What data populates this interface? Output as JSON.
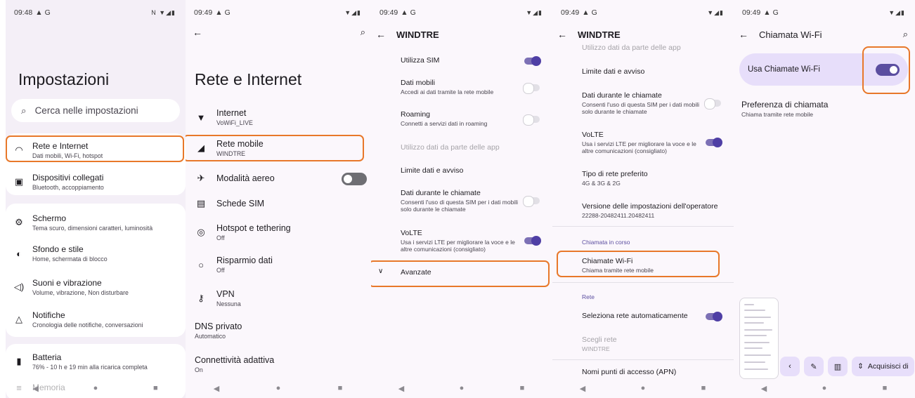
{
  "colors": {
    "highlight": "#e8782a",
    "accent": "#5b4ea0",
    "card_bg": "#e7defa"
  },
  "s1": {
    "time": "09:48",
    "status_icons": "▲ G",
    "status_right": "N ▼◢▮",
    "title": "Impostazioni",
    "search_placeholder": "Cerca nelle impostazioni",
    "items": [
      {
        "title": "Rete e Internet",
        "sub": "Dati mobili, Wi-Fi, hotspot",
        "icon": "wifi-icon"
      },
      {
        "title": "Dispositivi collegati",
        "sub": "Bluetooth, accoppiamento",
        "icon": "devices-icon"
      },
      {
        "title": "Schermo",
        "sub": "Tema scuro, dimensioni caratteri, luminosità",
        "icon": "brightness-icon"
      },
      {
        "title": "Sfondo e stile",
        "sub": "Home, schermata di blocco",
        "icon": "palette-icon"
      },
      {
        "title": "Suoni e vibrazione",
        "sub": "Volume, vibrazione, Non disturbare",
        "icon": "volume-icon"
      },
      {
        "title": "Notifiche",
        "sub": "Cronologia delle notifiche, conversazioni",
        "icon": "bell-icon"
      },
      {
        "title": "Batteria",
        "sub": "76% - 10 h e 19 min alla ricarica completa",
        "icon": "battery-icon"
      },
      {
        "title": "Memoria",
        "sub": "",
        "icon": "storage-icon"
      }
    ]
  },
  "s2": {
    "time": "09:49",
    "title": "Rete e Internet",
    "items": [
      {
        "title": "Internet",
        "sub": "VoWiFi_LIVE"
      },
      {
        "title": "Rete mobile",
        "sub": "WINDTRE"
      },
      {
        "title": "Modalità aereo",
        "sub": ""
      },
      {
        "title": "Schede SIM",
        "sub": ""
      },
      {
        "title": "Hotspot e tethering",
        "sub": "Off"
      },
      {
        "title": "Risparmio dati",
        "sub": "Off"
      },
      {
        "title": "VPN",
        "sub": "Nessuna"
      },
      {
        "title": "DNS privato",
        "sub": "Automatico"
      },
      {
        "title": "Connettività adattiva",
        "sub": "On"
      }
    ]
  },
  "s3": {
    "time": "09:49",
    "title": "WINDTRE",
    "rows": [
      {
        "title": "Utilizza SIM",
        "sub": ""
      },
      {
        "title": "Dati mobili",
        "sub": "Accedi ai dati tramite la rete mobile"
      },
      {
        "title": "Roaming",
        "sub": "Connetti a servizi dati in roaming"
      },
      {
        "title": "Utilizzo dati da parte delle app",
        "sub": ""
      },
      {
        "title": "Limite dati e avviso",
        "sub": ""
      },
      {
        "title": "Dati durante le chiamate",
        "sub": "Consenti l'uso di questa SIM per i dati mobili solo durante le chiamate"
      },
      {
        "title": "VoLTE",
        "sub": "Usa i servizi LTE per migliorare la voce e le altre comunicazioni (consigliato)"
      },
      {
        "title": "Avanzate",
        "sub": ""
      }
    ]
  },
  "s4": {
    "time": "09:49",
    "title": "WINDTRE",
    "rows": [
      {
        "title": "Utilizzo dati da parte delle app",
        "sub": ""
      },
      {
        "title": "Limite dati e avviso",
        "sub": ""
      },
      {
        "title": "Dati durante le chiamate",
        "sub": "Consenti l'uso di questa SIM per i dati mobili solo durante le chiamate"
      },
      {
        "title": "VoLTE",
        "sub": "Usa i servizi LTE per migliorare la voce e le altre comunicazioni (consigliato)"
      },
      {
        "title": "Tipo di rete preferito",
        "sub": "4G & 3G & 2G"
      },
      {
        "title": "Versione delle impostazioni dell'operatore",
        "sub": "22288-20482411.20482411"
      },
      {
        "title": "Chiamate Wi-Fi",
        "sub": "Chiama tramite rete mobile"
      },
      {
        "title": "Seleziona rete automaticamente",
        "sub": ""
      },
      {
        "title": "Scegli rete",
        "sub": "WINDTRE"
      },
      {
        "title": "Nomi punti di accesso (APN)",
        "sub": ""
      }
    ],
    "section_call": "Chiamata in corso",
    "section_net": "Rete"
  },
  "s5": {
    "time": "09:49",
    "title": "Chiamata Wi-Fi",
    "toggle_label": "Usa Chiamate Wi-Fi",
    "pref_title": "Preferenza di chiamata",
    "pref_sub": "Chiama tramite rete mobile",
    "capture_label": "Acquisisci di"
  }
}
